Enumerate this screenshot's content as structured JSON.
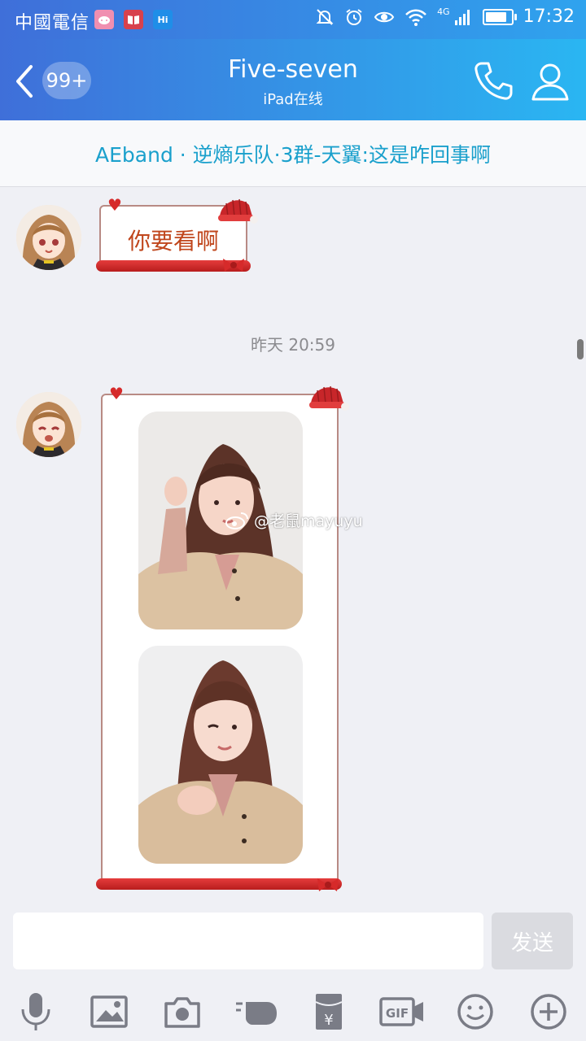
{
  "status_bar": {
    "carrier": "中國電信",
    "notification_icons": [
      "pig-app-icon",
      "book-app-icon",
      "hi-app-icon"
    ],
    "hi_label": "Hi",
    "network": "4G",
    "time": "17:32",
    "battery_level": 0.85,
    "system_icons": [
      "mute-icon",
      "alarm-icon",
      "eye-icon",
      "wifi-icon",
      "signal-icon",
      "battery-icon"
    ]
  },
  "header": {
    "unread_badge": "99+",
    "title": "Five-seven",
    "subtitle": "iPad在线"
  },
  "banner": {
    "text": "AEband · 逆熵乐队·3群-天翼:这是咋回事啊"
  },
  "messages": [
    {
      "type": "text",
      "text": "你要看啊"
    },
    {
      "type": "timestamp",
      "text": "昨天 20:59"
    },
    {
      "type": "image_collage",
      "watermark": "@老鼠mayuyu",
      "images": 2
    }
  ],
  "input": {
    "placeholder": "",
    "send_label": "发送"
  },
  "toolbar": {
    "items": [
      "mic-icon",
      "image-icon",
      "camera-icon",
      "poke-icon",
      "red-packet-icon",
      "gif-icon",
      "emoji-icon",
      "plus-icon"
    ],
    "gif_label": "GIF",
    "yen_label": "¥"
  },
  "colors": {
    "header_start": "#3f6fd9",
    "header_end": "#2ab6f2",
    "banner_text": "#1aa0cc",
    "chat_bg": "#eff0f5",
    "message_text": "#c0461c",
    "frame_red": "#d62a2a"
  }
}
